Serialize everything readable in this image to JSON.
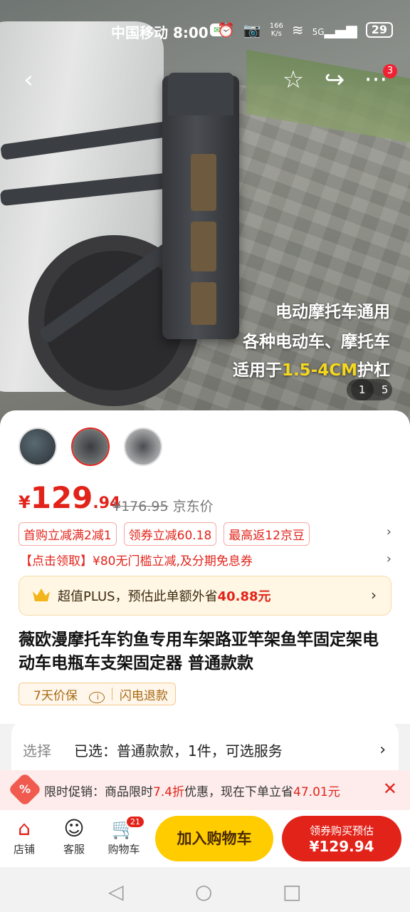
{
  "status_bar": {
    "carrier": "中国移动",
    "time": "8:00",
    "wechat_icon": "wechat-icon",
    "net_speed": "166\nK/s",
    "signal": "5G",
    "battery": "29"
  },
  "top_nav": {
    "back": "‹",
    "favorite": "☆",
    "share": "↪",
    "more": "···",
    "more_badge": "3"
  },
  "hero": {
    "overlay_lines": [
      "电动摩托车通用",
      "各种电动车、摩托车"
    ],
    "overlay_line3_prefix": "适用于",
    "overlay_line3_highlight": "1.5-4CM",
    "overlay_line3_suffix": "护杠",
    "pager_current": "1",
    "pager_total": "5"
  },
  "price": {
    "currency": "¥",
    "main": "129",
    "decimal": ".94",
    "original": "¥176.95",
    "original_label": "京东价"
  },
  "coupons": [
    "首购立减满2减1",
    "领券立减60.18",
    "最高返12京豆"
  ],
  "coupon_arrow": "›",
  "promo_line": "【点击领取】¥80无门槛立减,及分期免息券",
  "promo_arrow": "›",
  "plus": {
    "label": "超值PLUS，预估此单额外省",
    "amount": "40.88元",
    "arrow": "›"
  },
  "product_title": "薇欧漫摩托车钓鱼专用车架路亚竿架鱼竿固定架电动车电瓶车支架固定器 普通款款",
  "services": {
    "price_protect": "7天价保",
    "refund": "闪电退款"
  },
  "selection": {
    "label": "选择",
    "value": "已选：普通款款，1件，可选服务",
    "arrow": "›"
  },
  "limited_promo": {
    "prefix": "限时促销：商品限时",
    "discount": "7.4折",
    "middle": "优惠，现在下单立省",
    "save": "47.01元",
    "close": "✕"
  },
  "bottom_bar": {
    "shop": "店铺",
    "service": "客服",
    "cart": "购物车",
    "cart_badge": "21",
    "add_to_cart": "加入购物车",
    "buy_line1": "领券购买预估",
    "buy_line2": "¥129.94"
  },
  "colors": {
    "accent_red": "#e2231a",
    "cart_yellow": "#ffcc00",
    "highlight_yellow": "#f4d71f"
  }
}
